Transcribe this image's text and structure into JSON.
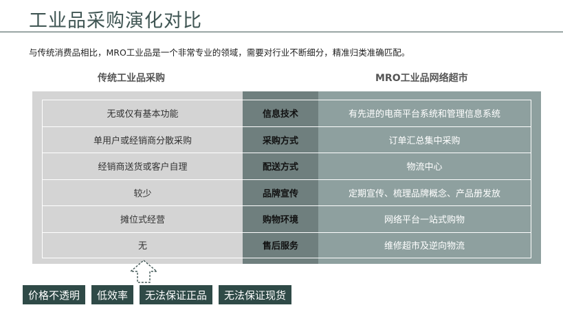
{
  "title": "工业品采购演化对比",
  "subtitle": "与传统消费品相比，MRO工业品是一个非常专业的领域，需要对行业不断细分，精准归类准确匹配。",
  "columns": {
    "left": "传统工业品采购",
    "right": "MRO工业品网络超市"
  },
  "rows": [
    {
      "left": "无或仅有基本功能",
      "category": "信息技术",
      "right": "有先进的电商平台系统和管理信息系统"
    },
    {
      "left": "单用户或经销商分散采购",
      "category": "采购方式",
      "right": "订单汇总集中采购"
    },
    {
      "left": "经销商送货或客户自理",
      "category": "配送方式",
      "right": "物流中心"
    },
    {
      "left": "较少",
      "category": "品牌宣传",
      "right": "定期宣传、梳理品牌概念、产品册发放"
    },
    {
      "left": "摊位式经营",
      "category": "购物环境",
      "right": "网络平台一站式购物"
    },
    {
      "left": "无",
      "category": "售后服务",
      "right": "维修超市及逆向物流"
    }
  ],
  "tags": [
    "价格不透明",
    "低效率",
    "无法保证正品",
    "无法保证现货"
  ],
  "colors": {
    "accent": "#3f5553",
    "left_bg": "#d4d4d4",
    "mid_bg": "#6f7f7e",
    "right_bg": "#8ea09f",
    "tag_bg": "#2f4a47"
  }
}
